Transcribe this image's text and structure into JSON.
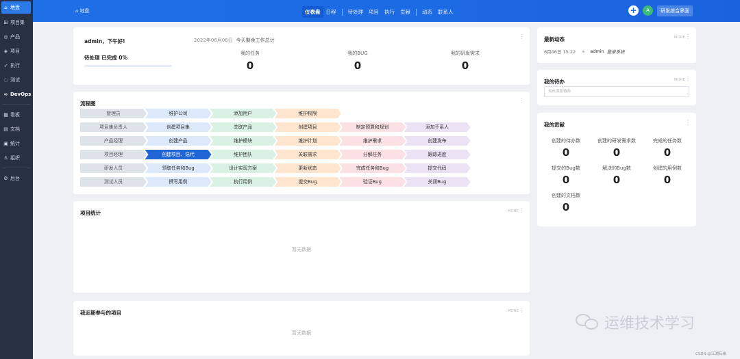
{
  "sidebar": {
    "items": [
      {
        "icon": "⌂",
        "label": "地盘",
        "active": true
      },
      {
        "icon": "⊞",
        "label": "项目集"
      },
      {
        "icon": "◎",
        "label": "产品"
      },
      {
        "icon": "◈",
        "label": "项目"
      },
      {
        "icon": "➶",
        "label": "执行"
      },
      {
        "icon": "◌",
        "label": "测试"
      },
      {
        "icon": "∞",
        "label": "DevOps"
      },
      {
        "icon": "▦",
        "label": "看板"
      },
      {
        "icon": "▤",
        "label": "文档"
      },
      {
        "icon": "▣",
        "label": "统计"
      },
      {
        "icon": "♙",
        "label": "组织"
      },
      {
        "icon": "⚙",
        "label": "后台"
      }
    ]
  },
  "topbar": {
    "crumb_icon": "⌂",
    "crumb": "地盘",
    "nav": [
      "仪表盘",
      "日程",
      "待处理",
      "项目",
      "执行",
      "贡献",
      "动态",
      "联系人"
    ],
    "plus": "+",
    "avatar": "A",
    "switch_label": "研发综合界面"
  },
  "welcome": {
    "greeting": "admin，下午好!",
    "pending": "待处理 已完成 0%",
    "progress": 0,
    "date": "2022年06月06日",
    "summary": "今天剩余工作总计",
    "stats": [
      {
        "label": "我的任务",
        "value": "0"
      },
      {
        "label": "我的BUG",
        "value": "0"
      },
      {
        "label": "我的研发需求",
        "value": "0"
      }
    ]
  },
  "flow": {
    "title": "流程图",
    "rows": [
      {
        "role": "管理员",
        "steps": [
          "维护公司",
          "添加用户",
          "维护权限"
        ]
      },
      {
        "role": "项目集负责人",
        "steps": [
          "创建项目集",
          "关联产品",
          "创建项目",
          "制定预算和规划",
          "添加干系人"
        ]
      },
      {
        "role": "产品经理",
        "steps": [
          "创建产品",
          "维护模块",
          "维护计划",
          "维护需求",
          "创建发布"
        ]
      },
      {
        "role": "项目经理",
        "steps": [
          "创建项目、迭代",
          "维护团队",
          "关联需求",
          "分解任务",
          "跟踪进度"
        ]
      },
      {
        "role": "研发人员",
        "steps": [
          "领取任务和Bug",
          "设计实现方案",
          "更新状态",
          "完成任务和Bug",
          "提交代码"
        ]
      },
      {
        "role": "测试人员",
        "steps": [
          "撰写用例",
          "执行用例",
          "提交Bug",
          "验证Bug",
          "关闭Bug"
        ]
      }
    ]
  },
  "project_stats": {
    "title": "项目统计",
    "more": "MORE",
    "empty": "暂无数据"
  },
  "recent_projects": {
    "title": "我近期参与的项目",
    "more": "MORE",
    "empty": "暂无数据"
  },
  "dynamics": {
    "title": "最新动态",
    "more": "MORE",
    "time": "6月06日 15:22",
    "user": "admin",
    "action": "登录系统"
  },
  "todo": {
    "title": "我的待办",
    "more": "MORE",
    "placeholder": "点击添加待办"
  },
  "contribution": {
    "title": "我的贡献",
    "items": [
      {
        "label": "创建的待办数",
        "value": "0"
      },
      {
        "label": "创建的研发需求数",
        "value": "0"
      },
      {
        "label": "完成的任务数",
        "value": "0"
      },
      {
        "label": "提交的Bug数",
        "value": "0"
      },
      {
        "label": "解决的Bug数",
        "value": "0"
      },
      {
        "label": "创建的用例数",
        "value": "0"
      },
      {
        "label": "创建的文档数",
        "value": "0"
      }
    ]
  },
  "watermark": {
    "text": "运维技术学习"
  },
  "footer": {
    "credit": "CSDN @江湖有缘"
  }
}
